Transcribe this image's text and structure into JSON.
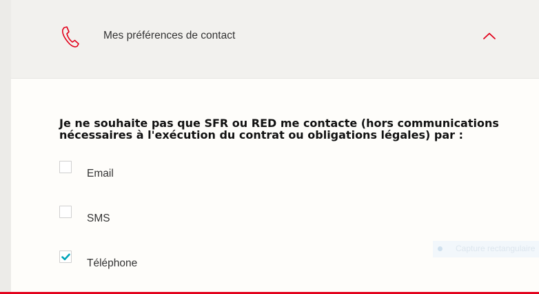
{
  "header": {
    "title": "Mes préférences de contact",
    "icon": "phone-icon",
    "toggle_icon": "chevron-up-icon",
    "accent_color": "#e2001a"
  },
  "body": {
    "question": "Je ne souhaite pas que SFR ou RED me contacte (hors communications nécessaires à l'exécution du contrat ou obligations légales) par :",
    "options": [
      {
        "label": "Email",
        "checked": false
      },
      {
        "label": "SMS",
        "checked": false
      },
      {
        "label": "Téléphone",
        "checked": true
      }
    ],
    "check_color": "#00a4b8"
  },
  "overlay": {
    "label": "Capture rectangulaire"
  }
}
